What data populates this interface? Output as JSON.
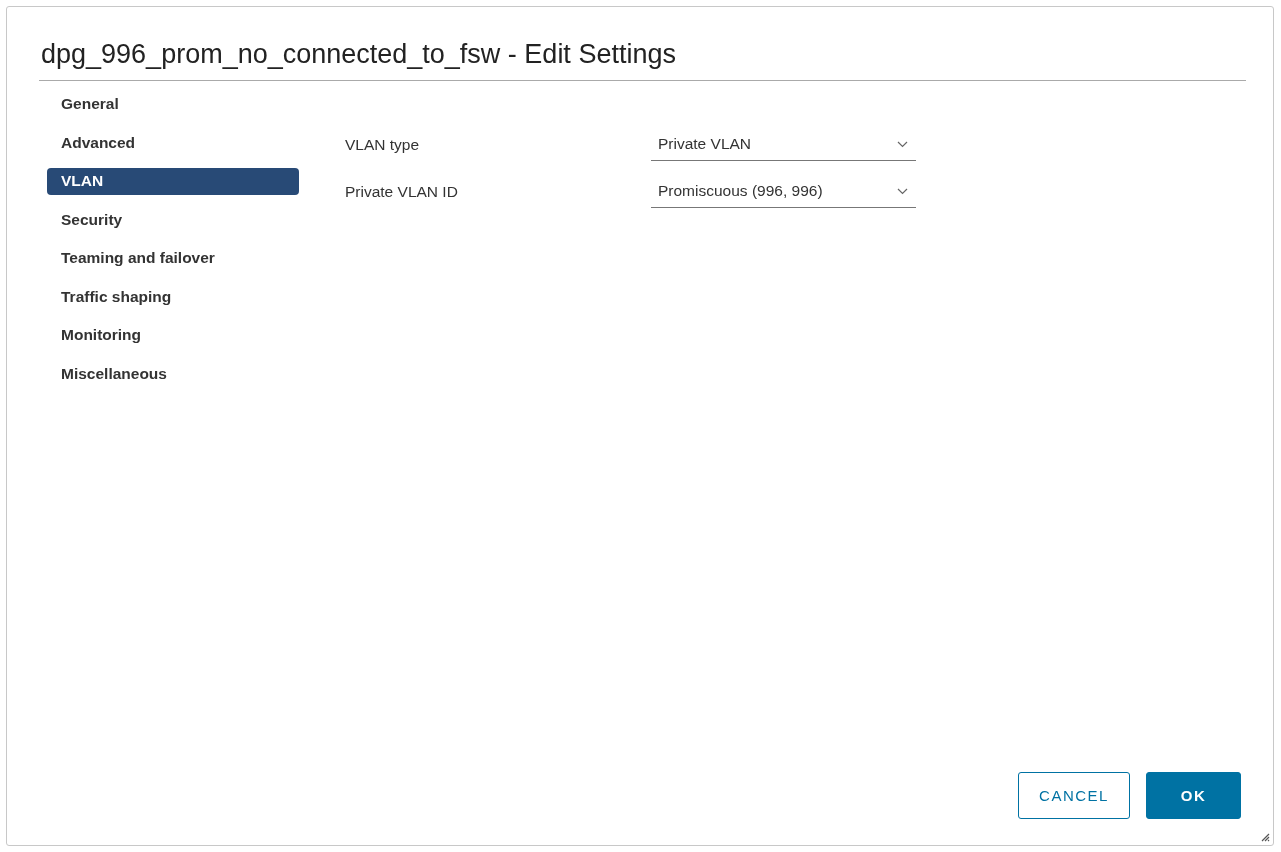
{
  "dialog": {
    "title": "dpg_996_prom_no_connected_to_fsw - Edit Settings"
  },
  "sidebar": {
    "items": [
      {
        "label": "General",
        "selected": false
      },
      {
        "label": "Advanced",
        "selected": false
      },
      {
        "label": "VLAN",
        "selected": true
      },
      {
        "label": "Security",
        "selected": false
      },
      {
        "label": "Teaming and failover",
        "selected": false
      },
      {
        "label": "Traffic shaping",
        "selected": false
      },
      {
        "label": "Monitoring",
        "selected": false
      },
      {
        "label": "Miscellaneous",
        "selected": false
      }
    ]
  },
  "fields": [
    {
      "label": "VLAN type",
      "value": "Private VLAN"
    },
    {
      "label": "Private VLAN ID",
      "value": "Promiscuous (996, 996)"
    }
  ],
  "buttons": [
    {
      "label": "CANCEL",
      "kind": "secondary"
    },
    {
      "label": "OK",
      "kind": "primary"
    }
  ]
}
